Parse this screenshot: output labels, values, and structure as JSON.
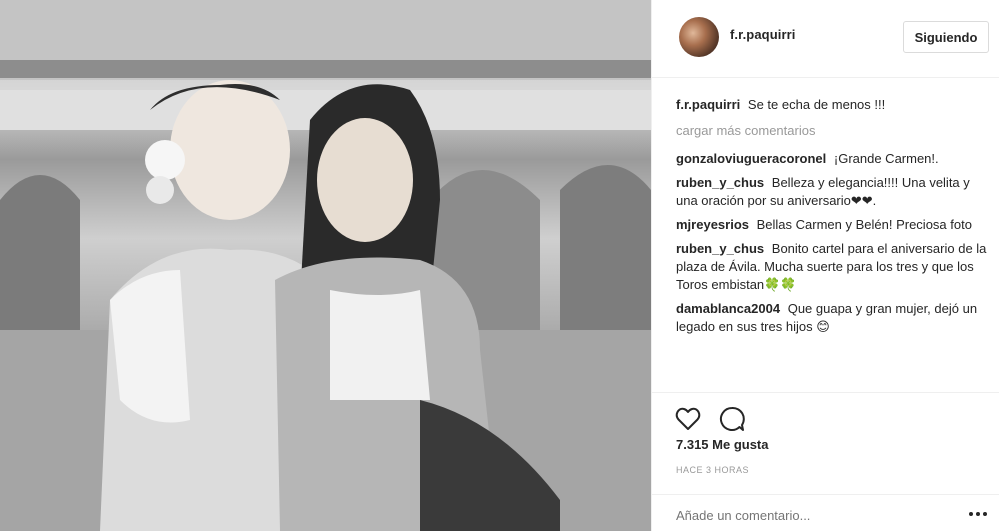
{
  "post": {
    "image_alt": "Fotografía en blanco y negro de dos mujeres sonrientes con peinetas y mantillas",
    "author": "f.r.paquirri",
    "follow_label": "Siguiendo",
    "caption": {
      "user": "f.r.paquirri",
      "text": "Se te echa de menos !!!"
    },
    "load_more": "cargar más comentarios",
    "comments": [
      {
        "user": "gonzaloviugueracoronel",
        "text": "¡Grande Carmen!."
      },
      {
        "user": "ruben_y_chus",
        "text": "Belleza y elegancia!!!! Una velita y una oración por su aniversario❤❤."
      },
      {
        "user": "mjreyesrios",
        "text": "Bellas Carmen y Belén! Preciosa foto"
      },
      {
        "user": "ruben_y_chus",
        "text": "Bonito cartel para el aniversario de la plaza de Ávila. Mucha suerte para los tres y que los Toros embistan🍀🍀"
      },
      {
        "user": "damablanca2004",
        "text": "Que guapa y gran mujer, dejó un legado en sus tres hijos 😊"
      }
    ],
    "likes": "7.315 Me gusta",
    "timestamp": "HACE 3 HORAS",
    "add_comment_placeholder": "Añade un comentario..."
  },
  "icons": {
    "like": "heart-icon",
    "comment": "comment-icon",
    "more": "more-options-icon"
  }
}
